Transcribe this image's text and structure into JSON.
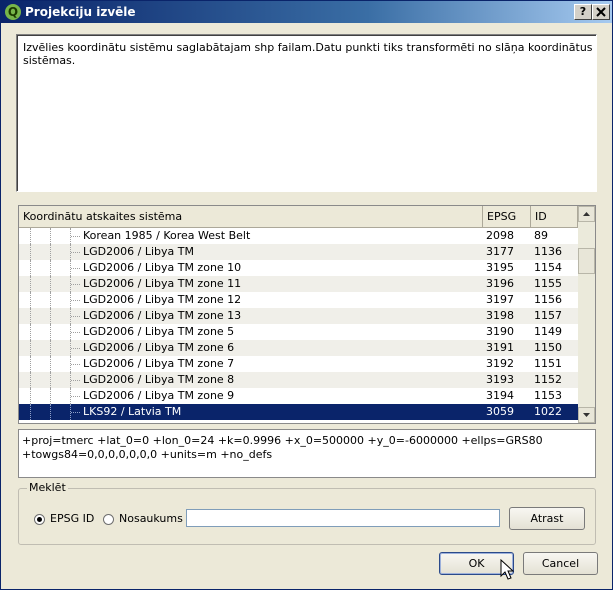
{
  "window": {
    "title": "Projekciju izvēle",
    "help_label": "?",
    "close_label": "X"
  },
  "description": "Izvēlies koordinātu sistēmu saglabātajam shp failam.Datu punkti tiks transformēti no slāņa koordinātus sistēmas.",
  "tree": {
    "columns": {
      "name": "Koordinātu atskaites sistēma",
      "epsg": "EPSG",
      "id": "ID"
    },
    "rows": [
      {
        "name": "Korean 1985 / Korea West Belt",
        "epsg": "2098",
        "id": "89"
      },
      {
        "name": "LGD2006 / Libya TM",
        "epsg": "3177",
        "id": "1136"
      },
      {
        "name": "LGD2006 / Libya TM zone 10",
        "epsg": "3195",
        "id": "1154"
      },
      {
        "name": "LGD2006 / Libya TM zone 11",
        "epsg": "3196",
        "id": "1155"
      },
      {
        "name": "LGD2006 / Libya TM zone 12",
        "epsg": "3197",
        "id": "1156"
      },
      {
        "name": "LGD2006 / Libya TM zone 13",
        "epsg": "3198",
        "id": "1157"
      },
      {
        "name": "LGD2006 / Libya TM zone 5",
        "epsg": "3190",
        "id": "1149"
      },
      {
        "name": "LGD2006 / Libya TM zone 6",
        "epsg": "3191",
        "id": "1150"
      },
      {
        "name": "LGD2006 / Libya TM zone 7",
        "epsg": "3192",
        "id": "1151"
      },
      {
        "name": "LGD2006 / Libya TM zone 8",
        "epsg": "3193",
        "id": "1152"
      },
      {
        "name": "LGD2006 / Libya TM zone 9",
        "epsg": "3194",
        "id": "1153"
      },
      {
        "name": "LKS92 / Latvia TM",
        "epsg": "3059",
        "id": "1022"
      }
    ],
    "selected_index": 11
  },
  "projection": {
    "line1": "+proj=tmerc +lat_0=0 +lon_0=24 +k=0.9996 +x_0=500000 +y_0=-6000000 +ellps=GRS80",
    "line2": "+towgs84=0,0,0,0,0,0,0 +units=m +no_defs"
  },
  "search": {
    "group_label": "Meklēt",
    "option_epsg": "EPSG ID",
    "option_name": "Nosaukums",
    "value": "",
    "find_label": "Atrast"
  },
  "buttons": {
    "ok": "OK",
    "cancel": "Cancel"
  },
  "colors": {
    "titlebar": "#0a246a",
    "selection": "#0a246a"
  }
}
